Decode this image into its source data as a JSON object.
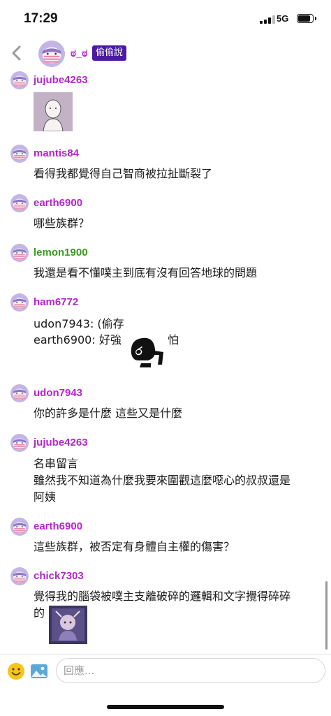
{
  "status_bar": {
    "time": "17:29",
    "network": "5G"
  },
  "header": {
    "author": "ಠ_ಠ",
    "badge": "偷偷說"
  },
  "comments": [
    {
      "username": "jujube4263",
      "lines": []
    },
    {
      "username": "mantis84",
      "lines": [
        "看得我都覺得自己智商被拉扯斷裂了"
      ]
    },
    {
      "username": "earth6900",
      "lines": [
        "哪些族群？"
      ]
    },
    {
      "username": "lemon1900",
      "lines": [
        "我還是看不懂噗主到底有沒有回答地球的問題"
      ]
    },
    {
      "username": "ham6772",
      "lines": [
        "udon7943: (偷存",
        "earth6900: 好強",
        "怕"
      ]
    },
    {
      "username": "udon7943",
      "lines": [
        "你的許多是什麼 這些又是什麼"
      ]
    },
    {
      "username": "jujube4263",
      "lines": [
        "名串留言",
        "雖然我不知道為什麼我要來圍觀這麼噁心的叔叔還是",
        "阿姨"
      ]
    },
    {
      "username": "earth6900",
      "lines": [
        "這些族群，被否定有身體自主權的傷害？"
      ]
    },
    {
      "username": "chick7303",
      "lines": [
        "覺得我的腦袋被噗主支離破碎的邏輯和文字攪得碎碎",
        "的"
      ]
    }
  ],
  "input": {
    "placeholder": "回應..."
  },
  "colors": {
    "username": "#b227c9",
    "username_green": "#3a9a1f",
    "badge": "#4a1aa3"
  },
  "icons": [
    "back-chevron-icon",
    "emoji-icon",
    "image-icon"
  ]
}
